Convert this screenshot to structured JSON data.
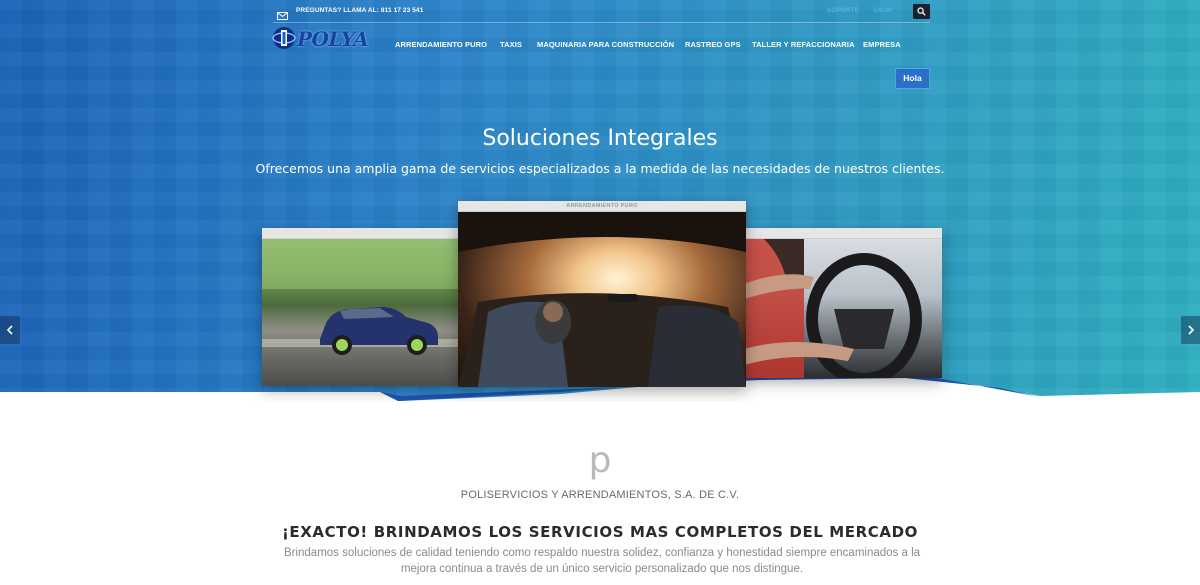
{
  "topbar": {
    "phone_text": "PREGUNTAS? LLAMA AL: 811 17 23 541",
    "soporte_label": "SOPORTE",
    "salir_label": "SALIR"
  },
  "logo": {
    "text": "POLYA"
  },
  "nav": {
    "items": [
      {
        "label": "ARRENDAMIENTO PURO"
      },
      {
        "label": "TAXIS"
      },
      {
        "label": "MAQUINARIA PARA CONSTRUCCIÓN"
      },
      {
        "label": "RASTREO GPS"
      },
      {
        "label": "TALLER Y REFACCIONARIA"
      },
      {
        "label": "EMPRESA"
      }
    ]
  },
  "hola_label": "Hola",
  "hero": {
    "title": "Soluciones Integrales",
    "subtitle": "Ofrecemos una amplia gama de servicios especializados a la medida de las necesidades de nuestros clientes.",
    "center_window_title": "ARRENDAMIENTO PURO"
  },
  "content": {
    "logo_glyph": "p",
    "company_name": "POLISERVICIOS Y ARRENDAMIENTOS, S.A. DE C.V.",
    "headline": "¡EXACTO! BRINDAMOS LOS SERVICIOS MAS COMPLETOS DEL MERCADO",
    "description": "Brindamos soluciones de calidad teniendo como respaldo nuestra solidez, confianza y honestidad siempre encaminados a la mejora continua a través de un único servicio personalizado que nos distingue."
  },
  "colors": {
    "hero_blue": "#2b82c9",
    "link_blue": "#4fb2ea",
    "logo_blue": "#1344a6",
    "wave_blue": "#1d54b0"
  },
  "icons": [
    "mail-icon",
    "search-icon",
    "chevron-left-icon",
    "chevron-right-icon"
  ]
}
